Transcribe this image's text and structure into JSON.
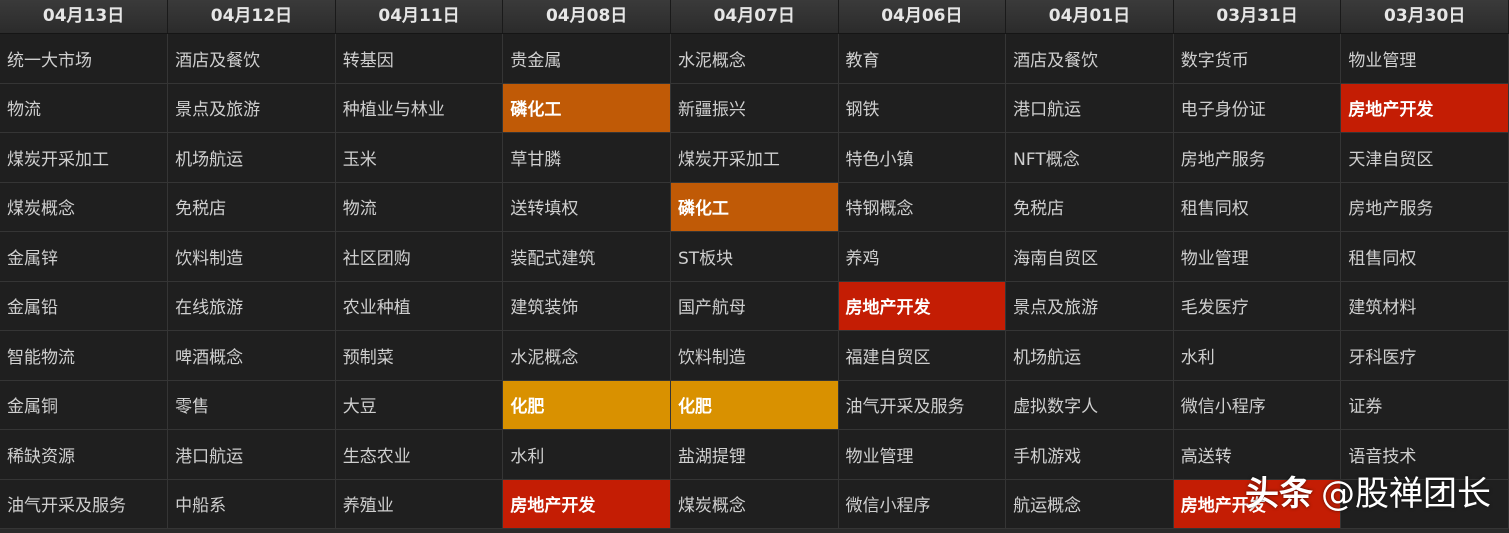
{
  "table": {
    "headers": [
      "04月13日",
      "04月12日",
      "04月11日",
      "04月08日",
      "04月07日",
      "04月06日",
      "04月01日",
      "03月31日",
      "03月30日"
    ],
    "rows": [
      [
        "统一大市场",
        "酒店及餐饮",
        "转基因",
        "贵金属",
        "水泥概念",
        "教育",
        "酒店及餐饮",
        "数字货币",
        "物业管理"
      ],
      [
        "物流",
        "景点及旅游",
        "种植业与林业",
        "磷化工",
        "新疆振兴",
        "钢铁",
        "港口航运",
        "电子身份证",
        "房地产开发"
      ],
      [
        "煤炭开采加工",
        "机场航运",
        "玉米",
        "草甘膦",
        "煤炭开采加工",
        "特色小镇",
        "NFT概念",
        "房地产服务",
        "天津自贸区"
      ],
      [
        "煤炭概念",
        "免税店",
        "物流",
        "送转填权",
        "磷化工",
        "特钢概念",
        "免税店",
        "租售同权",
        "房地产服务"
      ],
      [
        "金属锌",
        "饮料制造",
        "社区团购",
        "装配式建筑",
        "ST板块",
        "养鸡",
        "海南自贸区",
        "物业管理",
        "租售同权"
      ],
      [
        "金属铅",
        "在线旅游",
        "农业种植",
        "建筑装饰",
        "国产航母",
        "房地产开发",
        "景点及旅游",
        "毛发医疗",
        "建筑材料"
      ],
      [
        "智能物流",
        "啤酒概念",
        "预制菜",
        "水泥概念",
        "饮料制造",
        "福建自贸区",
        "机场航运",
        "水利",
        "牙科医疗"
      ],
      [
        "金属铜",
        "零售",
        "大豆",
        "化肥",
        "化肥",
        "油气开采及服务",
        "虚拟数字人",
        "微信小程序",
        "证券"
      ],
      [
        "稀缺资源",
        "港口航运",
        "生态农业",
        "水利",
        "盐湖提锂",
        "物业管理",
        "手机游戏",
        "高送转",
        "语音技术"
      ],
      [
        "油气开采及服务",
        "中船系",
        "养殖业",
        "房地产开发",
        "煤炭概念",
        "微信小程序",
        "航运概念",
        "房地产开发",
        ""
      ]
    ],
    "highlights": {
      "1-3": "hl-orange",
      "3-4": "hl-orange",
      "1-8": "hl-red",
      "5-5": "hl-red",
      "9-3": "hl-red",
      "9-7": "hl-red",
      "7-3": "hl-gold",
      "7-4": "hl-gold"
    }
  },
  "colors": {
    "orange": "#c05a06",
    "red": "#c41d04",
    "gold": "#d99100"
  },
  "watermark": {
    "brand": "头条",
    "handle": "@股禅团长"
  }
}
